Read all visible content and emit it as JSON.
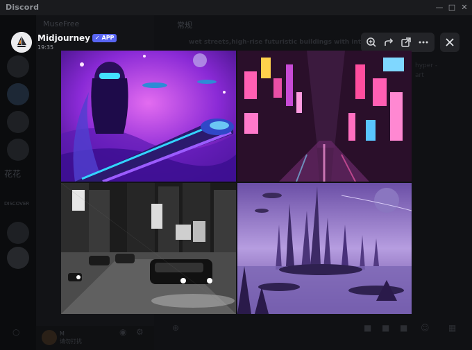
{
  "window": {
    "title": "Discord"
  },
  "background": {
    "server_name": "MuseFree",
    "channel_name": "常规",
    "message_snippet": "wet streets,high-rise futuristic buildings with inte",
    "side_text": [
      "hyper -",
      "art"
    ],
    "server_label_1": "花花",
    "server_label_2": "DISCOVER",
    "user": {
      "name": "M",
      "status": "请勿打扰"
    }
  },
  "message": {
    "author": "Midjourney Bot",
    "badge": "APP",
    "time": "19:35"
  },
  "toolbar": {
    "zoom": "zoom-in-icon",
    "forward": "forward-icon",
    "open": "open-external-icon",
    "more": "more-icon",
    "close": "close-icon"
  },
  "images": [
    {
      "description_icon": "cyberpunk-woman-train-image",
      "palette": [
        "#3a0d80",
        "#c23be0",
        "#2ad1ff"
      ]
    },
    {
      "description_icon": "neon-city-street-image",
      "palette": [
        "#1b0a1e",
        "#e04fa6",
        "#5fd2ff"
      ]
    },
    {
      "description_icon": "rainy-city-cars-image",
      "palette": [
        "#222222",
        "#9a9a9a",
        "#f0f0f0"
      ]
    },
    {
      "description_icon": "alien-spire-city-image",
      "palette": [
        "#4a2e7a",
        "#9b7fd0",
        "#d8c8f0"
      ]
    }
  ]
}
